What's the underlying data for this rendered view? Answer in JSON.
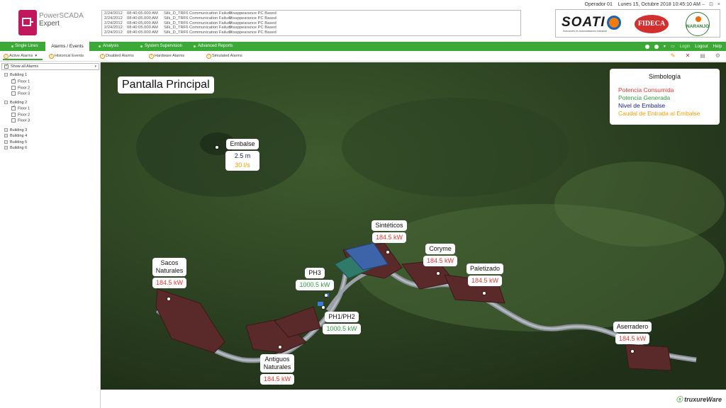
{
  "header": {
    "product_name_line1": "PowerSCADA",
    "product_name_line2": "Expert",
    "user": "Operador 01",
    "datetime": "Lunes 15, Octubre 2018  10:45:10 AM",
    "window_controls": "– ⊡ ×",
    "alarm_rows": [
      {
        "date": "2/24/2012",
        "time": "08:40:05.000 AM",
        "source": "Silk_D_TRF6",
        "message": "Communication Failure",
        "desc": "Disappearance PC Based"
      },
      {
        "date": "2/24/2012",
        "time": "08:40:05.000 AM",
        "source": "Silk_D_TRF6",
        "message": "Communication Failure",
        "desc": "Disappearance PC Based"
      },
      {
        "date": "2/24/2012",
        "time": "08:40:05.000 AM",
        "source": "Silk_D_TRF6",
        "message": "Communication Failure",
        "desc": "Disappearance PC Based"
      },
      {
        "date": "2/24/2012",
        "time": "08:40:05.000 AM",
        "source": "Silk_D_TRF6",
        "message": "Communication Failure",
        "desc": "Disappearance PC Based"
      },
      {
        "date": "2/24/2012",
        "time": "08:40:05.000 AM",
        "source": "Silk_D_TRF6",
        "message": "Communication Failure",
        "desc": "Disappearance PC Based"
      }
    ],
    "brands": {
      "soati": "SOATI",
      "soati_sub": "Soluciones en Automatización Industrial",
      "fideca": "FIDECA",
      "naranjo": "NARANJO"
    }
  },
  "nav": {
    "tabs": [
      "Single Lines",
      "Alarms / Events",
      "Analysis",
      "System Supervision",
      "Advanced Reports"
    ],
    "login": "Login",
    "logout": "Logout",
    "help": "Help"
  },
  "subbar": {
    "items": [
      "Active Alarms",
      "Historical Events",
      "Disabled Alarms",
      "Hardware Alarms",
      "Simulated Alarms"
    ]
  },
  "sidebar": {
    "show_all": "Show all Alarms",
    "buildings": [
      {
        "name": "Building 1",
        "floors": [
          "Floor 1",
          "Floor 2",
          "Floor 3"
        ]
      },
      {
        "name": "Building 2",
        "floors": [
          "Floor 1",
          "Floor 2",
          "Floor 3"
        ]
      },
      {
        "name": "Building 3"
      },
      {
        "name": "Building 4"
      },
      {
        "name": "Building 5"
      },
      {
        "name": "Building 6"
      }
    ]
  },
  "map": {
    "title": "Pantalla Principal",
    "legend": {
      "title": "Simbología",
      "items": [
        {
          "label": "Potencia Consumida",
          "color": "#e53935"
        },
        {
          "label": "Potencia Generada",
          "color": "#2e9e3e"
        },
        {
          "label": "Nivel de Embalse",
          "color": "#1a237e"
        },
        {
          "label": "Caudal de Entrada al Embalse",
          "color": "#f59b00"
        }
      ]
    },
    "plants": {
      "embalse": {
        "name": "Embalse",
        "level": "2.5 m",
        "flow": "30 l/s"
      },
      "sinteticos": {
        "name": "Sintéticos",
        "value": "184.5 kW"
      },
      "coryme": {
        "name": "Coryme",
        "value": "184.5 kW"
      },
      "paletizado": {
        "name": "Paletizado",
        "value": "184.5 kW"
      },
      "ph3": {
        "name": "PH3",
        "value": "1000.5 kW"
      },
      "ph1ph2": {
        "name": "PH1/PH2",
        "value": "1000.5 kW"
      },
      "sacos": {
        "name_line1": "Sacos",
        "name_line2": "Naturales",
        "value": "184.5 kW"
      },
      "antiguos": {
        "name_line1": "Antiguos",
        "name_line2": "Naturales",
        "value": "184.5 kW"
      },
      "aserradero": {
        "name": "Aserradero",
        "value": "184.5 kW"
      }
    }
  },
  "footer": {
    "brand_prefix": "tx",
    "brand": "truxureWare"
  }
}
